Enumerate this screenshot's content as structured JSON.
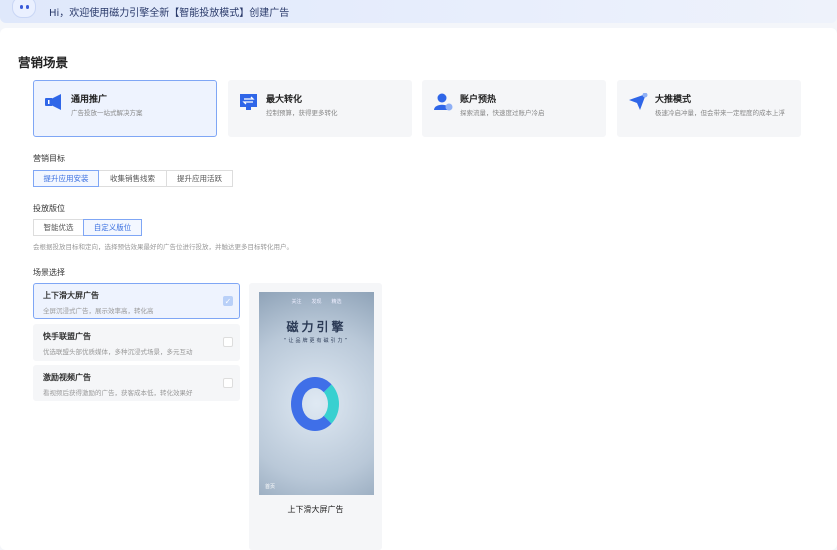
{
  "banner": {
    "text": "Hi，欢迎使用磁力引擎全新【智能投放模式】创建广告"
  },
  "section_title": "营销场景",
  "scenes": [
    {
      "name": "通用推广",
      "desc": "广告投放一站式解决方案",
      "icon": "megaphone-icon"
    },
    {
      "name": "最大转化",
      "desc": "控制预算，获得更多转化",
      "icon": "transfer-icon"
    },
    {
      "name": "账户预热",
      "desc": "探索流量，快速度过账户冷启",
      "icon": "user-clock-icon"
    },
    {
      "name": "大推模式",
      "desc": "极速冷启冲量，但会带来一定程度的成本上浮",
      "icon": "paper-plane-icon"
    }
  ],
  "goal": {
    "label": "营销目标",
    "options": [
      "提升应用安装",
      "收集销售线索",
      "提升应用活跃"
    ]
  },
  "placement": {
    "label": "投放版位",
    "options": [
      "智能优选",
      "自定义版位"
    ],
    "help": "会根据投放目标和定向，选择预估效果最好的广告位进行投放，并触达更多目标转化用户。"
  },
  "scene_select": {
    "label": "场景选择",
    "items": [
      {
        "name": "上下滑大屏广告",
        "desc": "全屏沉浸式广告，展示效率高，转化高",
        "checked": true
      },
      {
        "name": "快手联盟广告",
        "desc": "优选联盟头部优质媒体，多种沉浸式场景，多元互动",
        "checked": false
      },
      {
        "name": "激励视频广告",
        "desc": "看视频后获得激励的广告，获客成本低，转化效果好",
        "checked": false
      }
    ]
  },
  "preview": {
    "tabs": [
      "关注",
      "发现",
      "精选"
    ],
    "title": "磁力引擎",
    "subtitle": "“让品牌更有磁引力”",
    "home": "首页",
    "caption": "上下滑大屏广告"
  }
}
